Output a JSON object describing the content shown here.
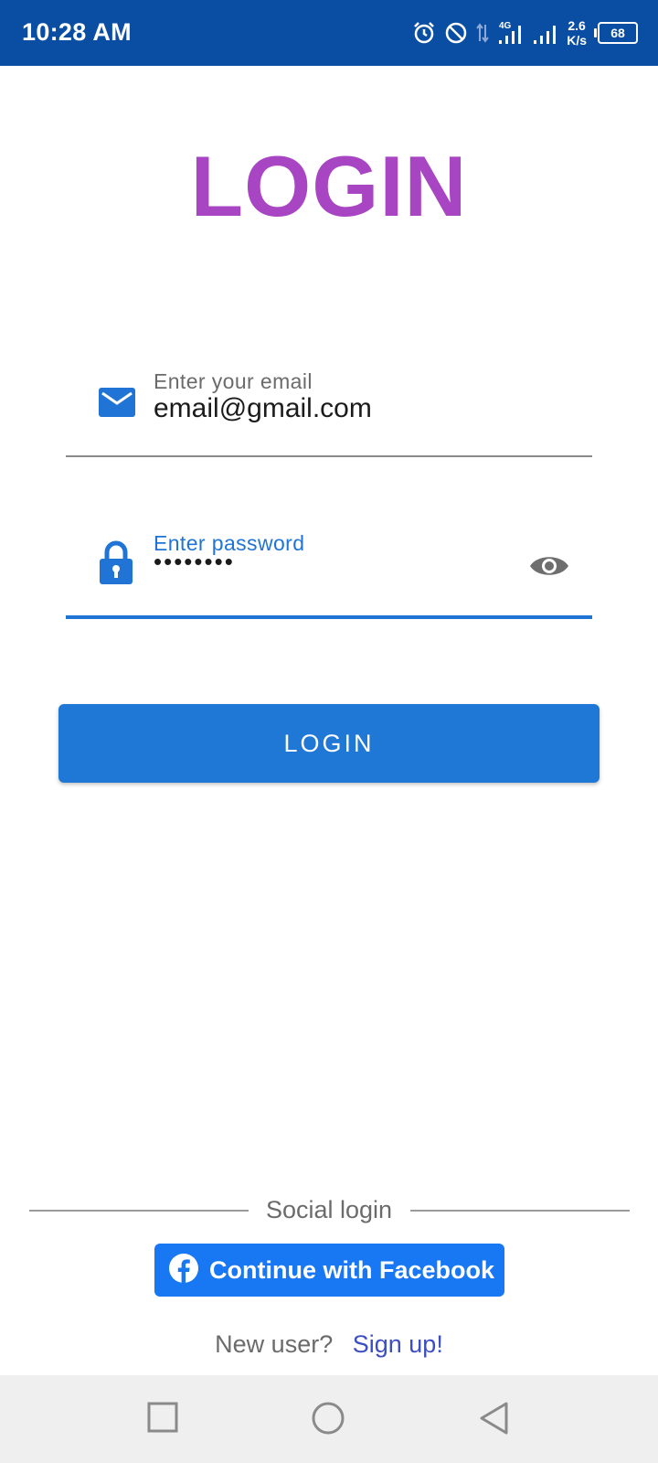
{
  "status_bar": {
    "time": "10:28 AM",
    "network_type": "4G",
    "speed_value": "2.6",
    "speed_unit": "K/s",
    "battery": "68",
    "icons": [
      "alarm-icon",
      "do-not-disturb-icon",
      "data-transfer-icon",
      "signal-icon",
      "signal-icon",
      "battery-icon"
    ]
  },
  "page": {
    "title": "LOGIN"
  },
  "email_field": {
    "label": "Enter your email",
    "value": "email@gmail.com",
    "icon": "mail-icon"
  },
  "password_field": {
    "label": "Enter password",
    "value": "••••••••",
    "icon": "lock-icon",
    "toggle_icon": "eye-icon"
  },
  "login_button": {
    "label": "LOGIN"
  },
  "social": {
    "label": "Social login",
    "facebook_label": "Continue with Facebook",
    "facebook_icon": "facebook-icon"
  },
  "signup": {
    "prompt": "New user?",
    "link": "Sign up!"
  },
  "colors": {
    "status_bar": "#0a4ea3",
    "title": "#a845c2",
    "primary": "#1f77d6",
    "facebook": "#1877f2",
    "link": "#3c4fc2"
  },
  "nav_bar": {
    "buttons": [
      "recents-square-icon",
      "home-circle-icon",
      "back-triangle-icon"
    ]
  }
}
